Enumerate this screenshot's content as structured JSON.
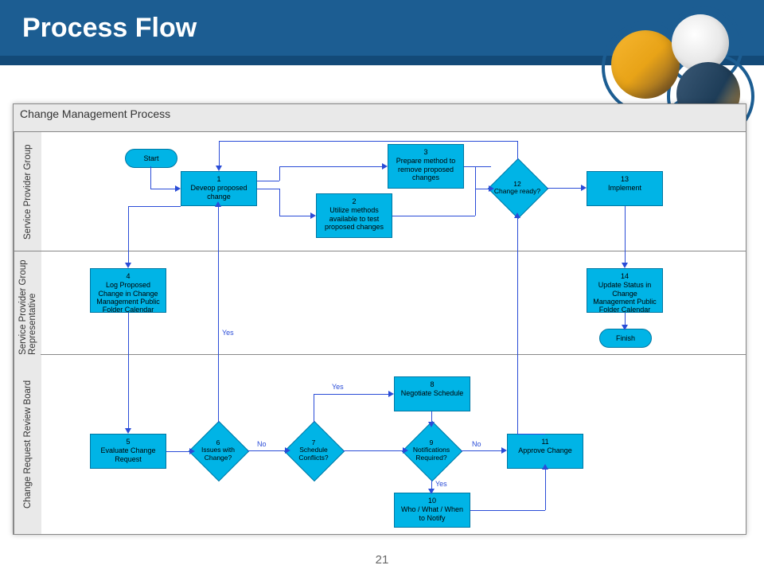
{
  "header": {
    "title": "Process Flow"
  },
  "panel": {
    "title": "Change Management Process"
  },
  "lanes": {
    "l1": "Service Provider Group",
    "l2": "Service Provider Group Representative",
    "l3": "Change Request Review Board"
  },
  "nodes": {
    "start": "Start",
    "finish": "Finish",
    "n1": {
      "num": "1",
      "text": "Deveop proposed change"
    },
    "n2": {
      "num": "2",
      "text": "Utilize methods available to test proposed changes"
    },
    "n3": {
      "num": "3",
      "text": "Prepare method to remove proposed changes"
    },
    "n4": {
      "num": "4",
      "text": "Log Proposed Change in Change Management Public Folder Calendar"
    },
    "n5": {
      "num": "5",
      "text": "Evaluate Change Request"
    },
    "n6": {
      "num": "6",
      "text": "Issues with Change?"
    },
    "n7": {
      "num": "7",
      "text": "Schedule Conflicts?"
    },
    "n8": {
      "num": "8",
      "text": "Negotiate Schedule"
    },
    "n9": {
      "num": "9",
      "text": "Notifications Required?"
    },
    "n10": {
      "num": "10",
      "text": "Who / What / When to Notify"
    },
    "n11": {
      "num": "11",
      "text": "Approve Change"
    },
    "n12": {
      "num": "12",
      "text": "Change ready?"
    },
    "n13": {
      "num": "13",
      "text": "Implement"
    },
    "n14": {
      "num": "14",
      "text": "Update Status in Change Management Public Folder Calendar"
    }
  },
  "edge_labels": {
    "yes": "Yes",
    "no": "No"
  },
  "page_number": "21"
}
